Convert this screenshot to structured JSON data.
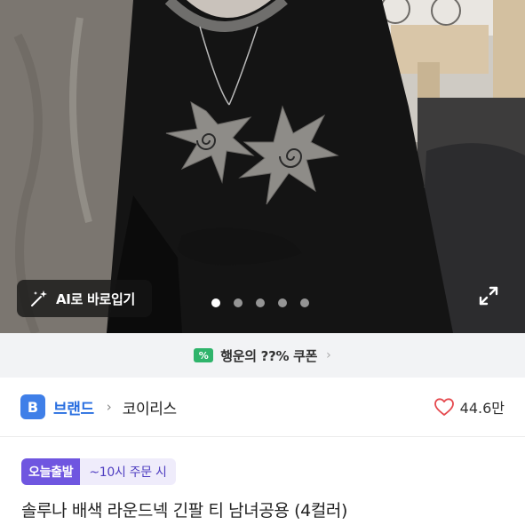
{
  "photo": {
    "ai_button_label": "AI로 바로입기",
    "ai_icon": "magic-wand-icon",
    "carousel": {
      "count": 5,
      "active_index": 0
    },
    "expand_icon": "expand-icon"
  },
  "coupon": {
    "icon": "coupon-percent-icon",
    "icon_glyph": "%",
    "text": "행운의 ??% 쿠폰",
    "chevron": "›"
  },
  "brand": {
    "badge": "B",
    "label": "브랜드",
    "separator": "›",
    "name": "코이리스"
  },
  "likes": {
    "icon": "heart-icon",
    "count": "44.6만"
  },
  "delivery": {
    "tag": "오늘출발",
    "note": "~10시 주문 시"
  },
  "product": {
    "title": "솔루나 배색 라운드넥 긴팔 티 남녀공용 (4컬러)"
  },
  "colors": {
    "brand_blue": "#3f7fe8",
    "delivery_purple": "#6f56e0",
    "heart_red": "#e5484d",
    "coupon_green": "#2fb46b"
  }
}
